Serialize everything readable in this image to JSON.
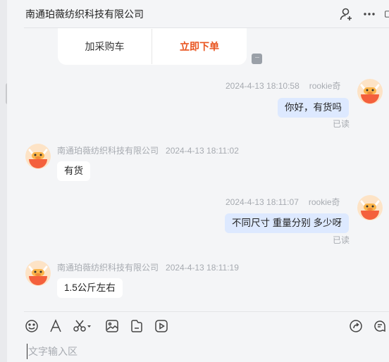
{
  "header": {
    "title": "南通珀薇纺织科技有限公司"
  },
  "card": {
    "cart_label": "加采购车",
    "order_label": "立即下单"
  },
  "messages": [
    {
      "side": "self",
      "name": "rookie奇",
      "time": "2024-4-13 18:10:58",
      "text": "你好，有货吗",
      "status": "已读"
    },
    {
      "side": "other",
      "name": "南通珀薇纺织科技有限公司",
      "time": "2024-4-13 18:11:02",
      "text": "有货"
    },
    {
      "side": "self",
      "name": "rookie奇",
      "time": "2024-4-13 18:11:07",
      "text": "不同尺寸 重量分别 多少呀",
      "status": "已读"
    },
    {
      "side": "other",
      "name": "南通珀薇纺织科技有限公司",
      "time": "2024-4-13 18:11:19",
      "text": "1.5公斤左右"
    }
  ],
  "input": {
    "placeholder": "文字输入区"
  },
  "icons": {
    "header": [
      "add-contact-icon",
      "more-icon"
    ],
    "toolbar": [
      "emoji-icon",
      "font-icon",
      "scissors-icon",
      "image-icon",
      "file-icon",
      "video-icon",
      "share-icon",
      "quick-reply-icon"
    ]
  },
  "colors": {
    "accent": "#e9541f",
    "self_bubble": "#dde9ff",
    "background": "#f4f5f7"
  }
}
